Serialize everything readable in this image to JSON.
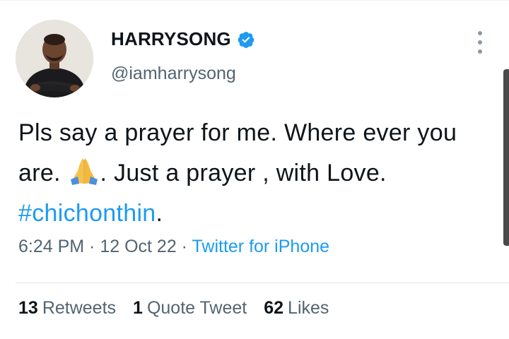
{
  "user": {
    "display_name": "HARRYSONG",
    "handle": "@iamharrysong",
    "verified": true
  },
  "tweet": {
    "text_part1": "Pls say a prayer for me. Where ever you are. ",
    "emoji": "folded-hands",
    "text_part2": ". Just a prayer , with Love. ",
    "hashtag": "#chichonthin",
    "text_part3": "."
  },
  "meta": {
    "time": "6:24 PM",
    "sep1": " · ",
    "date": "12 Oct 22",
    "sep2": " · ",
    "source": "Twitter for iPhone"
  },
  "stats": {
    "retweets_count": "13",
    "retweets_label": "Retweets",
    "quotes_count": "1",
    "quotes_label": "Quote Tweet",
    "likes_count": "62",
    "likes_label": "Likes"
  },
  "colors": {
    "accent": "#1d9bf0",
    "text": "#0f1419",
    "muted": "#536471"
  }
}
